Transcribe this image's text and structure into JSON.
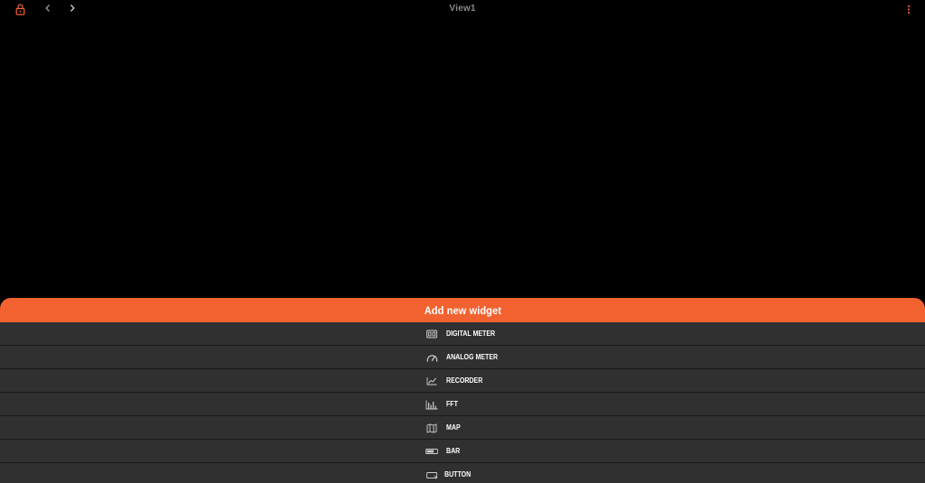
{
  "colors": {
    "accent": "#f26230",
    "background": "#000000",
    "list_item": "#303030",
    "title_text": "#8a8a8a"
  },
  "topbar": {
    "title": "View1",
    "lock_icon": "lock-icon",
    "back_icon": "chevron-left-icon",
    "forward_icon": "chevron-right-icon",
    "menu_icon": "more-vert-icon"
  },
  "sheet": {
    "title": "Add new widget",
    "items": [
      {
        "label": "DIGITAL METER",
        "icon": "digital-meter-icon"
      },
      {
        "label": "ANALOG METER",
        "icon": "gauge-icon"
      },
      {
        "label": "RECORDER",
        "icon": "line-chart-icon"
      },
      {
        "label": "FFT",
        "icon": "bar-chart-icon"
      },
      {
        "label": "MAP",
        "icon": "map-icon"
      },
      {
        "label": "BAR",
        "icon": "bar-icon"
      },
      {
        "label": "BUTTON",
        "icon": "button-icon"
      }
    ]
  }
}
